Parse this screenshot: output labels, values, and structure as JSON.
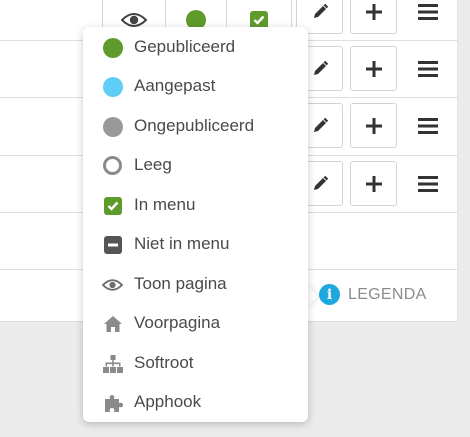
{
  "legend": {
    "button_label": "LEGENDA",
    "items": [
      {
        "label": "Gepubliceerd",
        "icon": "green-dot-icon",
        "color": "#5f9a2c"
      },
      {
        "label": "Aangepast",
        "icon": "light-blue-dot-icon",
        "color": "#5fcdf5"
      },
      {
        "label": "Ongepubliceerd",
        "icon": "grey-dot-icon",
        "color": "#999999"
      },
      {
        "label": "Leeg",
        "icon": "empty-ring-icon",
        "color": "#8a8a8a"
      },
      {
        "label": "In menu",
        "icon": "checkbox-checked-icon",
        "color": "#5f9a2c"
      },
      {
        "label": "Niet in menu",
        "icon": "checkbox-minus-icon",
        "color": "#555555"
      },
      {
        "label": "Toon pagina",
        "icon": "eye-icon",
        "color": "#6e6e6e"
      },
      {
        "label": "Voorpagina",
        "icon": "home-icon",
        "color": "#8a8a8a"
      },
      {
        "label": "Softroot",
        "icon": "sitemap-icon",
        "color": "#8a8a8a"
      },
      {
        "label": "Apphook",
        "icon": "puzzle-icon",
        "color": "#8a8a8a"
      }
    ]
  },
  "colors": {
    "accent_info": "#1fa8e0",
    "published_green": "#5f9a2c"
  }
}
